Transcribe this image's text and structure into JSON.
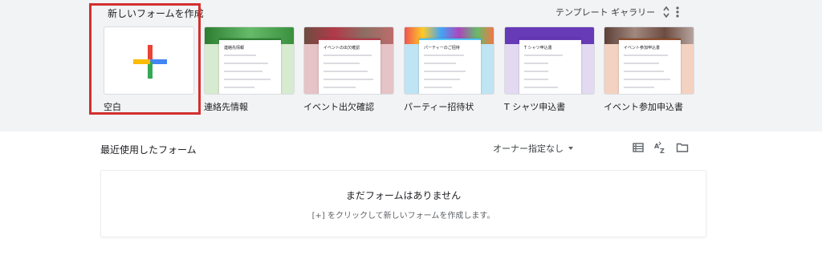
{
  "header": {
    "new_form_title": "新しいフォームを作成",
    "gallery_label": "テンプレート ギャラリー"
  },
  "templates": [
    {
      "label": "空白",
      "accent": "#ffffff"
    },
    {
      "label": "連絡先情報",
      "accent": "#2e7d32",
      "thumb_title": "連絡先情報"
    },
    {
      "label": "イベント出欠確認",
      "accent": "#b23a48",
      "thumb_title": "イベントの出欠確認"
    },
    {
      "label": "パーティー招待状",
      "accent": "#4fc3f7",
      "thumb_title": "パーティーのご招待"
    },
    {
      "label": "T シャツ申込書",
      "accent": "#673ab7",
      "thumb_title": "T シャツ申込書"
    },
    {
      "label": "イベント参加申込書",
      "accent": "#8d4b2b",
      "thumb_title": "イベント参加申込書"
    }
  ],
  "recent": {
    "title": "最近使用したフォーム",
    "owner_filter": "オーナー指定なし",
    "empty_title": "まだフォームはありません",
    "empty_subtitle": "[+] をクリックして新しいフォームを作成します。"
  },
  "colors": {
    "top_bg": "#f1f3f4",
    "highlight": "#d32f2f",
    "plus_red": "#ea4335",
    "plus_blue": "#4285f4",
    "plus_yellow": "#fbbc04",
    "plus_green": "#34a853"
  },
  "icons": [
    "sort-arrows-icon",
    "more-vert-icon",
    "list-view-icon",
    "sort-az-icon",
    "folder-icon"
  ]
}
